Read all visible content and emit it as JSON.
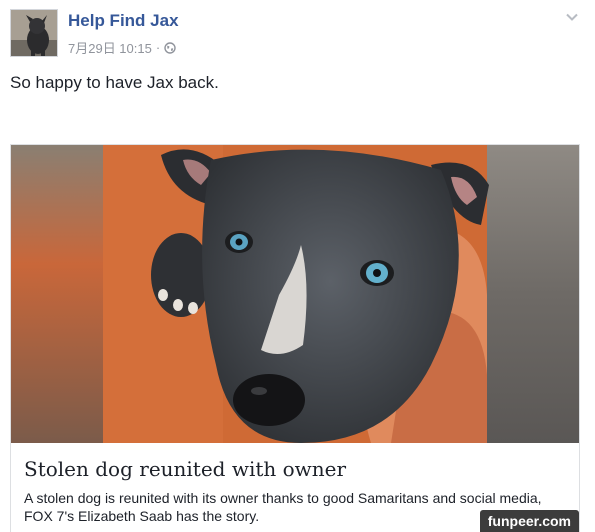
{
  "post": {
    "author": "Help Find Jax",
    "timestamp": "7月29日 10:15",
    "separator": "·",
    "privacy_icon": "globe-icon",
    "menu_icon": "chevron-down-icon",
    "text": "So happy to have Jax back."
  },
  "link_card": {
    "title": "Stolen dog reunited with owner",
    "description": "A stolen dog is reunited with its owner thanks to good Samaritans and social media, FOX 7's Elizabeth Saab has the story."
  },
  "watermark": "funpeer.com",
  "colors": {
    "link_blue": "#365899",
    "meta_gray": "#90949c",
    "text": "#1d2129",
    "border": "#dddfe2"
  }
}
